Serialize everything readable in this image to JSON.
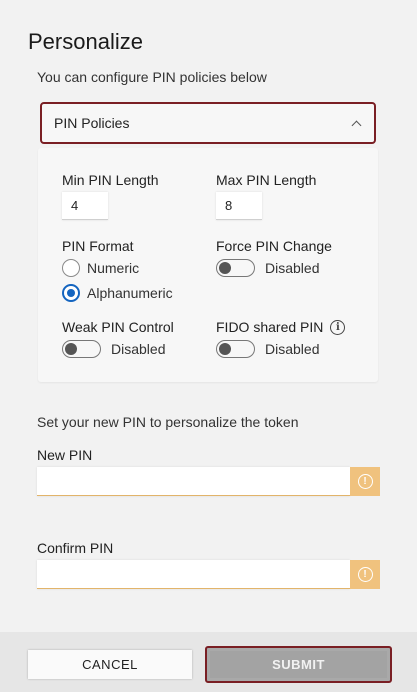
{
  "page": {
    "title": "Personalize",
    "subtitle": "You can configure PIN policies below"
  },
  "policies": {
    "header_label": "PIN Policies",
    "min_pin_length": {
      "label": "Min PIN Length",
      "value": "4"
    },
    "max_pin_length": {
      "label": "Max PIN Length",
      "value": "8"
    },
    "pin_format": {
      "label": "PIN Format",
      "options": [
        "Numeric",
        "Alphanumeric"
      ],
      "selected": "Alphanumeric"
    },
    "force_pin_change": {
      "label": "Force PIN Change",
      "state": "Disabled"
    },
    "weak_pin_control": {
      "label": "Weak PIN Control",
      "state": "Disabled"
    },
    "fido_shared_pin": {
      "label": "FIDO shared PIN",
      "state": "Disabled",
      "info_icon": "i"
    }
  },
  "personalize": {
    "instruction": "Set your new PIN to personalize the token",
    "new_pin": {
      "label": "New PIN",
      "value": "",
      "warning_icon": "!"
    },
    "confirm_pin": {
      "label": "Confirm PIN",
      "value": "",
      "warning_icon": "!"
    }
  },
  "footer": {
    "cancel_label": "CANCEL",
    "submit_label": "SUBMIT"
  },
  "colors": {
    "accent_border": "#7a1f24",
    "radio_selected": "#1565c0",
    "warning": "#f0c27e"
  }
}
